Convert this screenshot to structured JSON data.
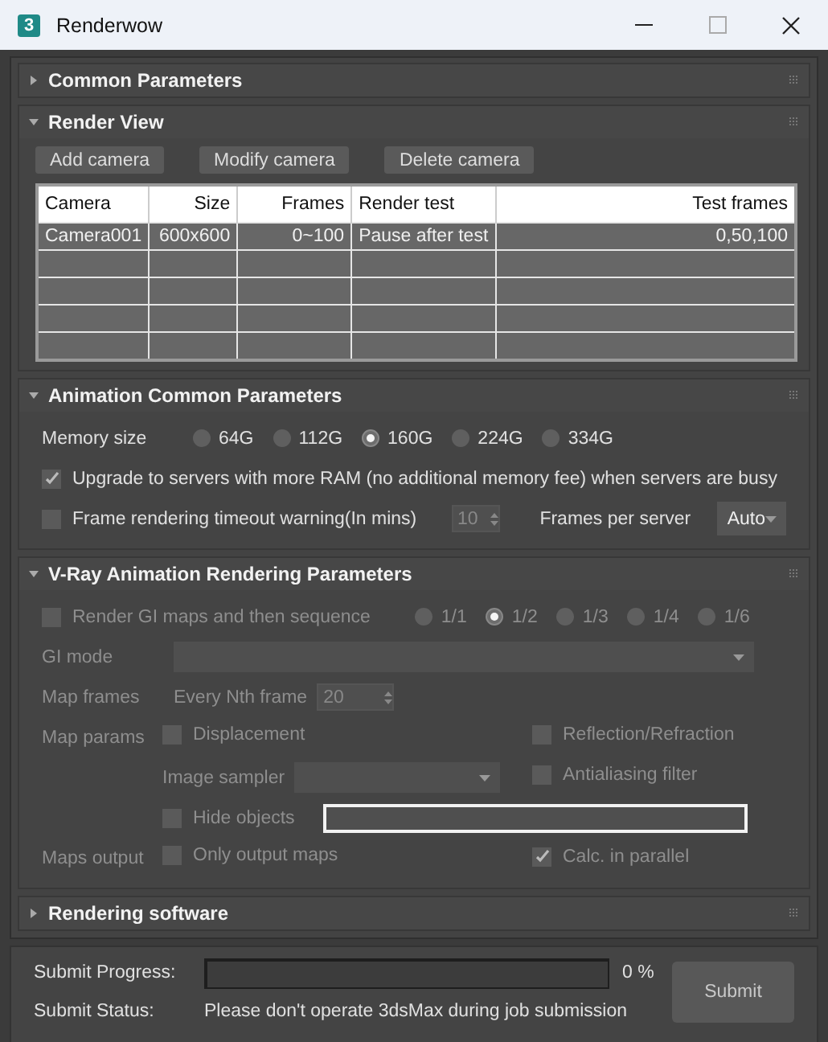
{
  "window": {
    "title": "Renderwow",
    "icon_label": "3"
  },
  "common_parameters": {
    "title": "Common Parameters",
    "expanded": false
  },
  "render_view": {
    "title": "Render View",
    "expanded": true,
    "buttons": [
      "Add camera",
      "Modify camera",
      "Delete camera"
    ],
    "table": {
      "columns": [
        "Camera",
        "Size",
        "Frames",
        "Render test",
        "Test frames"
      ],
      "rows": [
        [
          "Camera001",
          "600x600",
          "0~100",
          "Pause after test",
          "0,50,100"
        ]
      ]
    }
  },
  "animation": {
    "title": "Animation Common Parameters",
    "expanded": true,
    "memory_label": "Memory size",
    "memory_options": [
      {
        "label": "64G",
        "selected": false
      },
      {
        "label": "112G",
        "selected": false
      },
      {
        "label": "160G",
        "selected": true
      },
      {
        "label": "224G",
        "selected": false
      },
      {
        "label": "334G",
        "selected": false
      }
    ],
    "upgrade": {
      "label": "Upgrade to servers with more RAM (no additional memory fee) when servers are busy",
      "checked": true
    },
    "timeout": {
      "label": "Frame rendering timeout warning(In mins)",
      "checked": false,
      "value": "10"
    },
    "frames_per_server": {
      "label": "Frames per server",
      "value": "Auto"
    }
  },
  "vray": {
    "title": "V-Ray Animation Rendering Parameters",
    "expanded": true,
    "disabled": true,
    "render_gi": {
      "label": "Render GI maps and then sequence",
      "checked": false
    },
    "ratios": [
      {
        "label": "1/1",
        "selected": false
      },
      {
        "label": "1/2",
        "selected": true
      },
      {
        "label": "1/3",
        "selected": false
      },
      {
        "label": "1/4",
        "selected": false
      },
      {
        "label": "1/6",
        "selected": false
      }
    ],
    "gi_mode": {
      "label": "GI mode"
    },
    "map_frames": {
      "label": "Map frames",
      "sublabel": "Every Nth frame",
      "value": "20"
    },
    "map_params": {
      "label": "Map params",
      "displacement": {
        "label": "Displacement",
        "checked": false
      },
      "reflection": {
        "label": "Reflection/Refraction",
        "checked": false
      },
      "image_sampler": "Image sampler",
      "antialiasing": {
        "label": "Antialiasing filter",
        "checked": false
      },
      "hide_objects": {
        "label": "Hide objects",
        "checked": false
      }
    },
    "maps_output": {
      "label": "Maps output",
      "only_output": {
        "label": "Only output maps",
        "checked": false
      },
      "parallel": {
        "label": "Calc. in parallel",
        "checked": true
      }
    }
  },
  "rendering_software": {
    "title": "Rendering software",
    "expanded": false
  },
  "submit": {
    "progress_label": "Submit Progress:",
    "level": 0,
    "percent": "0 %",
    "status_label": "Submit Status:",
    "status": "Please don't operate 3dsMax during job submission",
    "button": "Submit"
  }
}
